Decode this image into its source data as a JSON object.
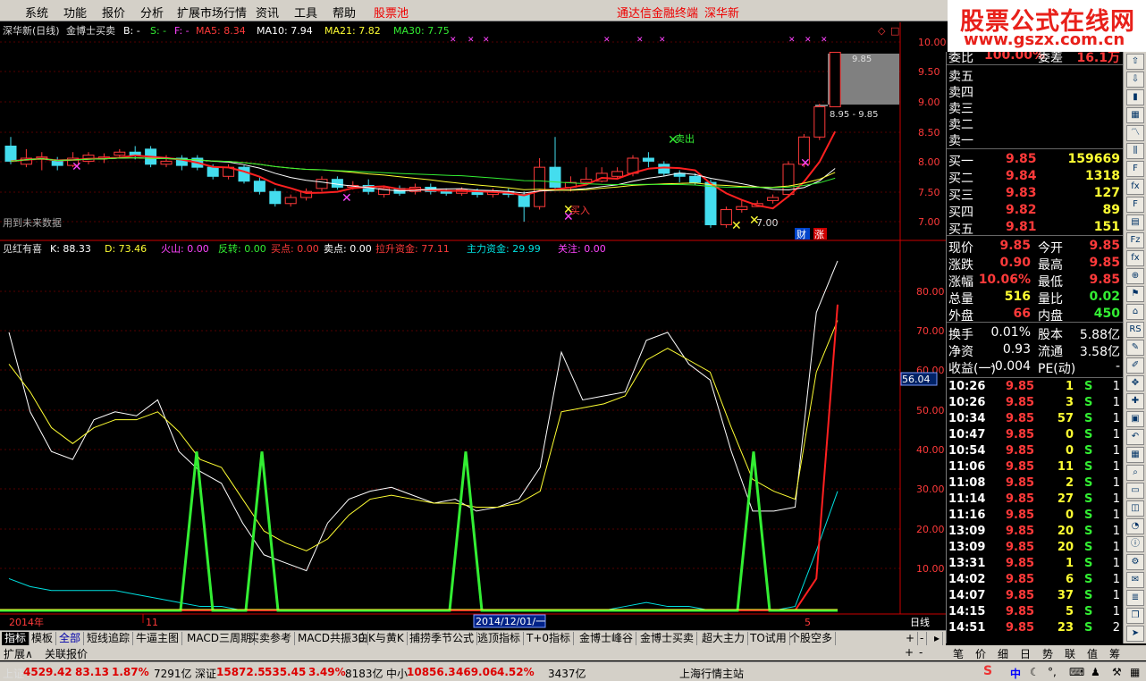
{
  "menu": {
    "items": [
      "系统",
      "功能",
      "报价",
      "分析",
      "扩展市场行情",
      "资讯",
      "工具",
      "帮助"
    ],
    "stock_pool": "股票池",
    "center_title": "通达信金融终端",
    "stock_name": "深华新"
  },
  "logo": {
    "line1": "股票公式在线网",
    "line2": "www.gszx.com.cn"
  },
  "main_legend": {
    "title": "深华新(日线)",
    "indicator": "金博士买卖",
    "b": "B: -",
    "s": "S: -",
    "f": "F: -",
    "ma5": "MA5: 8.34",
    "ma10": "MA10: 7.94",
    "ma21": "MA21: 7.82",
    "ma30": "MA30: 7.75"
  },
  "main_axis": [
    "10.00",
    "9.50",
    "9.00",
    "8.50",
    "8.00",
    "7.50",
    "7.00"
  ],
  "range_label_top": "9.85",
  "range_label_bottom": "8.95 - 9.85",
  "future_data_note": "用到未来数据",
  "candle_annotations": {
    "sell": "卖出",
    "buy": "买入",
    "limit": "7.00",
    "cai": "财",
    "zhang": "涨"
  },
  "sub_legend": {
    "name": "见红有喜",
    "k": "K: 88.33",
    "d": "D: 73.46",
    "huoshan": "火山: 0.00",
    "fanzhuan": "反转: 0.00",
    "maidian": "买点: 0.00",
    "maidian2": "卖点: 0.00",
    "lasheng": "拉升资金: 77.11",
    "zhuli": "主力资金: 29.99",
    "guanzhu": "关注: 0.00"
  },
  "sub_axis": [
    "80.00",
    "70.00",
    "60.00",
    "50.00",
    "40.00",
    "30.00",
    "20.00",
    "10.00"
  ],
  "sub_cursor_value": "56.04",
  "date_axis": {
    "y2014": "2014年",
    "m11": "11",
    "cursor_date": "2014/12/01/一",
    "m5": "5",
    "period": "日线"
  },
  "chart_data": {
    "type": "candlestick",
    "series": [
      {
        "name": "MA5",
        "color": "#ff2020"
      },
      {
        "name": "MA10",
        "color": "#ffffff"
      },
      {
        "name": "MA21",
        "color": "#ffff33"
      },
      {
        "name": "MA30",
        "color": "#33ee33"
      }
    ],
    "sub_series": [
      {
        "name": "K",
        "color": "#ffffff"
      },
      {
        "name": "D",
        "color": "#ffff33"
      },
      {
        "name": "拉升资金",
        "color": "#ff2020"
      },
      {
        "name": "主力资金",
        "color": "#00e0e0"
      },
      {
        "name": "买点",
        "color": "#33ee33"
      }
    ],
    "main_range": [
      6.8,
      10.05
    ],
    "sub_range": [
      0,
      90
    ],
    "candles": [
      [
        8.3,
        8.05,
        8.45,
        8.0
      ],
      [
        8.0,
        8.1,
        8.25,
        7.95
      ],
      [
        8.1,
        8.12,
        8.2,
        7.9
      ],
      [
        8.05,
        7.98,
        8.12,
        7.9
      ],
      [
        7.98,
        8.1,
        8.2,
        7.95
      ],
      [
        8.05,
        8.15,
        8.2,
        8.0
      ],
      [
        8.1,
        8.12,
        8.18,
        8.02
      ],
      [
        8.15,
        8.2,
        8.25,
        8.1
      ],
      [
        8.2,
        8.15,
        8.3,
        8.08
      ],
      [
        8.25,
        8.0,
        8.3,
        7.95
      ],
      [
        8.0,
        8.05,
        8.15,
        7.95
      ],
      [
        8.1,
        7.98,
        8.15,
        7.9
      ],
      [
        8.1,
        7.95,
        8.15,
        7.9
      ],
      [
        7.95,
        7.8,
        8.0,
        7.75
      ],
      [
        7.8,
        7.95,
        8.0,
        7.75
      ],
      [
        7.95,
        7.72,
        7.98,
        7.68
      ],
      [
        7.72,
        7.55,
        7.78,
        7.5
      ],
      [
        7.55,
        7.35,
        7.6,
        7.3
      ],
      [
        7.35,
        7.45,
        7.5,
        7.3
      ],
      [
        7.45,
        7.55,
        7.6,
        7.4
      ],
      [
        7.6,
        7.75,
        7.8,
        7.55
      ],
      [
        7.75,
        7.62,
        7.8,
        7.58
      ],
      [
        7.62,
        7.65,
        7.72,
        7.58
      ],
      [
        7.65,
        7.55,
        7.75,
        7.5
      ],
      [
        7.5,
        7.6,
        7.65,
        7.45
      ],
      [
        7.6,
        7.52,
        7.65,
        7.48
      ],
      [
        7.55,
        7.62,
        7.68,
        7.5
      ],
      [
        7.62,
        7.55,
        7.68,
        7.5
      ],
      [
        7.55,
        7.52,
        7.6,
        7.48
      ],
      [
        7.52,
        7.58,
        7.62,
        7.48
      ],
      [
        7.55,
        7.5,
        7.6,
        7.45
      ],
      [
        7.5,
        7.55,
        7.6,
        7.45
      ],
      [
        7.55,
        7.5,
        7.6,
        7.45
      ],
      [
        7.5,
        7.3,
        7.55,
        7.05
      ],
      [
        7.3,
        7.95,
        8.1,
        7.25
      ],
      [
        7.95,
        7.62,
        8.45,
        7.6
      ],
      [
        7.62,
        7.7,
        7.8,
        7.55
      ],
      [
        7.7,
        7.75,
        7.95,
        7.65
      ],
      [
        7.72,
        7.85,
        7.95,
        7.7
      ],
      [
        7.8,
        7.88,
        7.95,
        7.75
      ],
      [
        7.85,
        8.1,
        8.15,
        7.8
      ],
      [
        8.1,
        8.05,
        8.2,
        7.95
      ],
      [
        8.0,
        7.85,
        8.05,
        7.8
      ],
      [
        7.85,
        7.8,
        7.9,
        7.7
      ],
      [
        7.8,
        7.7,
        7.85,
        7.65
      ],
      [
        7.7,
        7.0,
        7.75,
        6.95
      ],
      [
        7.0,
        7.25,
        7.3,
        6.95
      ],
      [
        7.25,
        7.3,
        7.4,
        7.2
      ],
      [
        7.3,
        7.35,
        7.4,
        7.3
      ],
      [
        7.4,
        7.45,
        7.5,
        7.35
      ],
      [
        7.5,
        8.0,
        8.05,
        7.45
      ],
      [
        8.0,
        8.45,
        8.5,
        7.95
      ],
      [
        8.45,
        8.95,
        9.0,
        8.4
      ],
      [
        8.95,
        9.85,
        9.85,
        8.95
      ]
    ]
  },
  "quote": {
    "weibi_label": "委比",
    "weibi_val": "100.00%",
    "weicha_label": "委差",
    "weicha_val": "16.1万",
    "sells": [
      {
        "label": "卖五"
      },
      {
        "label": "卖四"
      },
      {
        "label": "卖三"
      },
      {
        "label": "卖二"
      },
      {
        "label": "卖一"
      }
    ],
    "buys": [
      {
        "label": "买一",
        "price": "9.85",
        "vol": "159669"
      },
      {
        "label": "买二",
        "price": "9.84",
        "vol": "1318"
      },
      {
        "label": "买三",
        "price": "9.83",
        "vol": "127"
      },
      {
        "label": "买四",
        "price": "9.82",
        "vol": "89"
      },
      {
        "label": "买五",
        "price": "9.81",
        "vol": "151"
      }
    ],
    "stats": [
      {
        "l1": "现价",
        "v1": "9.85",
        "l2": "今开",
        "v2": "9.85"
      },
      {
        "l1": "涨跌",
        "v1": "0.90",
        "l2": "最高",
        "v2": "9.85"
      },
      {
        "l1": "涨幅",
        "v1": "10.06%",
        "l2": "最低",
        "v2": "9.85"
      },
      {
        "l1": "总量",
        "v1": "516",
        "l2": "量比",
        "v2": "0.02"
      },
      {
        "l1": "外盘",
        "v1": "66",
        "l2": "内盘",
        "v2": "450"
      }
    ],
    "fin": [
      {
        "l1": "换手",
        "v1": "0.01%",
        "l2": "股本",
        "v2": "5.88亿"
      },
      {
        "l1": "净资",
        "v1": "0.93",
        "l2": "流通",
        "v2": "3.58亿"
      },
      {
        "l1": "收益(一)",
        "v1": "-0.004",
        "l2": "PE(动)",
        "v2": "-"
      }
    ],
    "ticks": [
      {
        "t": "10:26",
        "p": "9.85",
        "v": "1",
        "s": "S",
        "n": "1"
      },
      {
        "t": "10:26",
        "p": "9.85",
        "v": "3",
        "s": "S",
        "n": "1"
      },
      {
        "t": "10:34",
        "p": "9.85",
        "v": "57",
        "s": "S",
        "n": "1"
      },
      {
        "t": "10:47",
        "p": "9.85",
        "v": "0",
        "s": "S",
        "n": "1"
      },
      {
        "t": "10:54",
        "p": "9.85",
        "v": "0",
        "s": "S",
        "n": "1"
      },
      {
        "t": "11:06",
        "p": "9.85",
        "v": "11",
        "s": "S",
        "n": "1"
      },
      {
        "t": "11:08",
        "p": "9.85",
        "v": "2",
        "s": "S",
        "n": "1"
      },
      {
        "t": "11:14",
        "p": "9.85",
        "v": "27",
        "s": "S",
        "n": "1"
      },
      {
        "t": "11:16",
        "p": "9.85",
        "v": "0",
        "s": "S",
        "n": "1"
      },
      {
        "t": "13:09",
        "p": "9.85",
        "v": "20",
        "s": "S",
        "n": "1"
      },
      {
        "t": "13:09",
        "p": "9.85",
        "v": "20",
        "s": "S",
        "n": "1"
      },
      {
        "t": "13:31",
        "p": "9.85",
        "v": "1",
        "s": "S",
        "n": "1"
      },
      {
        "t": "14:02",
        "p": "9.85",
        "v": "6",
        "s": "S",
        "n": "1"
      },
      {
        "t": "14:07",
        "p": "9.85",
        "v": "37",
        "s": "S",
        "n": "1"
      },
      {
        "t": "14:15",
        "p": "9.85",
        "v": "5",
        "s": "S",
        "n": "1"
      },
      {
        "t": "14:51",
        "p": "9.85",
        "v": "23",
        "s": "S",
        "n": "2"
      }
    ]
  },
  "bottom_tabs": [
    "指标",
    "模板",
    "全部",
    "短线追踪",
    "牛逼主图",
    "MACD三周期",
    "买卖参考",
    "MACD共振30",
    "白K与黄K",
    "捕捞季节公式",
    "逃顶指标",
    "T+0指标",
    "金博士峰谷",
    "金博士买卖",
    "超大主力",
    "TO试用",
    "个股空多"
  ],
  "bottom_tabs2": [
    "扩展∧",
    "关联报价"
  ],
  "quote_tabs": [
    "笔",
    "价",
    "细",
    "日",
    "势",
    "联",
    "值",
    "筹"
  ],
  "status": {
    "sh_label": "上证",
    "sh_val": "4529.42",
    "sh_chg": "83.13",
    "sh_pct": "1.87%",
    "sh_amt": "7291亿",
    "sz_label": "深证",
    "sz_val": "15872.5",
    "sz_chg": "535.45",
    "sz_pct": "3.49%",
    "sz_amt": "8183亿",
    "zx_label": "中小",
    "zx_val": "10856.3",
    "zx_chg": "469.06",
    "zx_pct": "4.52%",
    "zx_amt": "3437亿",
    "station": "上海行情主站",
    "ime": "中"
  }
}
